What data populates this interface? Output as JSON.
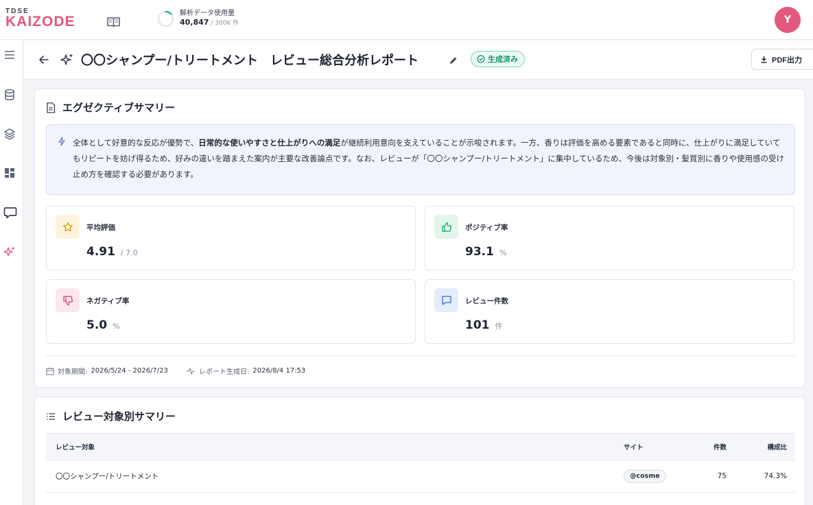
{
  "header": {
    "logo_small": "TDSE",
    "logo_main": "KAIZODE",
    "usage_label": "解析データ使用量",
    "usage_value": "40,847",
    "usage_total": " / 300K 件",
    "usage_fraction": 0.136,
    "avatar_initial": "Y",
    "colors": {
      "brand": "#e2587e",
      "ring": "#1fb89a"
    }
  },
  "rail": {
    "icons": [
      "menu-icon",
      "database-icon",
      "layers-icon",
      "dashboard-icon",
      "chat-icon",
      "sparkle-icon"
    ]
  },
  "titlebar": {
    "title": "〇〇シャンプー/トリートメント　レビュー総合分析レポート",
    "status": "生成済み",
    "pdf_label": "PDF出力"
  },
  "executive": {
    "title": "エグゼクティブサマリー",
    "text_1": "全体として好意的な反応が優勢で、",
    "text_bold": "日常的な使いやすさと仕上がりへの満足",
    "text_2": "が継続利用意向を支えていることが示唆されます。一方、香りは評価を高める要素であると同時に、仕上がりに満足していてもリピートを妨げ得るため、好みの違いを踏まえた案内が主要な改善論点です。なお、レビューが「〇〇シャンプー/トリートメント」に集中しているため、今後は対象別・髪質別に香りや使用感の受け止め方を確認する必要があります。",
    "metrics": [
      {
        "label": "平均評価",
        "value": "4.91",
        "unit": "/ 7.0",
        "icon": "star-icon"
      },
      {
        "label": "ポジティブ率",
        "value": "93.1",
        "unit": "%",
        "icon": "thumbs-up-icon"
      },
      {
        "label": "ネガティブ率",
        "value": "5.0",
        "unit": "%",
        "icon": "thumbs-down-icon"
      },
      {
        "label": "レビュー件数",
        "value": "101",
        "unit": "件",
        "icon": "message-icon"
      }
    ],
    "period_label": "対象期間:",
    "period_value": "2026/5/24 - 2026/7/23",
    "generated_label": "レポート生成日:",
    "generated_value": "2026/8/4 17:53"
  },
  "target_summary": {
    "title": "レビュー対象別サマリー",
    "columns": [
      "レビュー対象",
      "サイト",
      "件数",
      "構成比"
    ],
    "rows": [
      {
        "target": "〇〇シャンプー/トリートメント",
        "site": "@cosme",
        "count": "75",
        "ratio": "74.3%"
      }
    ]
  }
}
